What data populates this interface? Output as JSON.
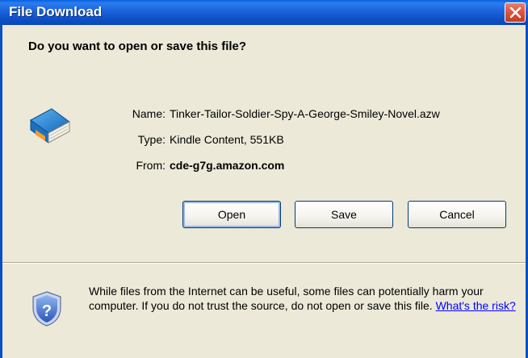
{
  "window": {
    "title": "File Download",
    "close_icon": "close-icon"
  },
  "dialog": {
    "question": "Do you want to open or save this file?",
    "file_icon": "kindle-book-icon",
    "fields": [
      {
        "label": "Name:",
        "value": "Tinker-Tailor-Soldier-Spy-A-George-Smiley-Novel.azw"
      },
      {
        "label": "Type:",
        "value": "Kindle Content, 551KB"
      },
      {
        "label": "From:",
        "value": "cde-g7g.amazon.com"
      }
    ],
    "buttons": {
      "open_label": "Open",
      "save_label": "Save",
      "cancel_label": "Cancel"
    },
    "warning": {
      "icon": "security-shield-question-icon",
      "text": "While files from the Internet can be useful, some files can potentially harm your computer. If you do not trust the source, do not open or save this file. ",
      "link_text": "What's the risk?"
    }
  },
  "colors": {
    "titlebar": "#0b4fc4",
    "dialog_background": "#ece9d8",
    "close_button": "#d9543a",
    "link": "#0000ff"
  }
}
